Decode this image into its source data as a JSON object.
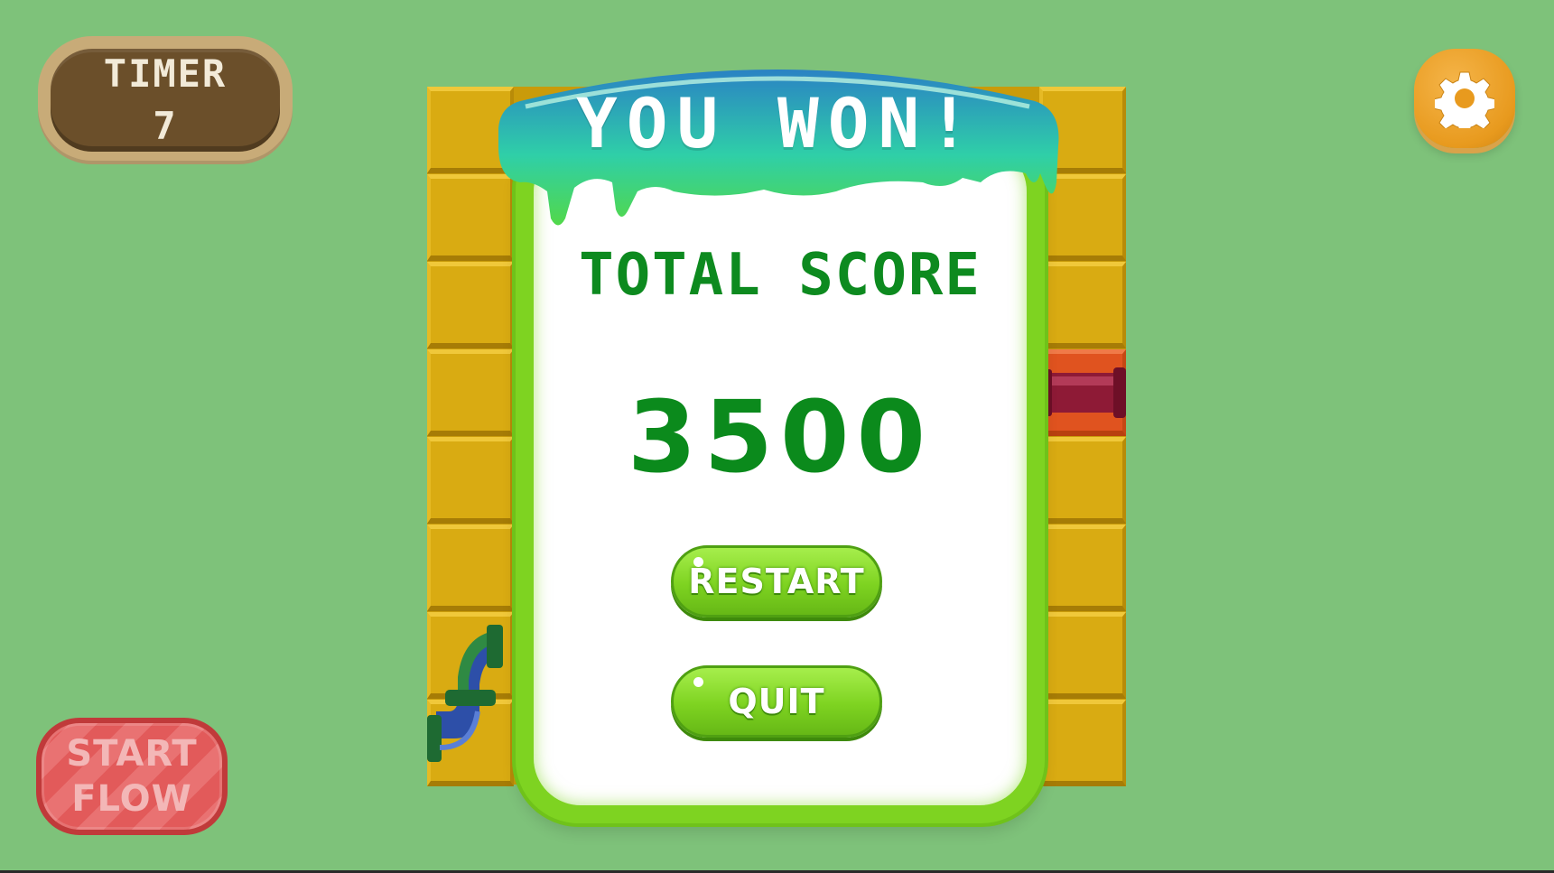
{
  "hud": {
    "timer_label": "TIMER",
    "timer_value": "7",
    "settings_icon": "gear-icon",
    "start_flow_line1": "START",
    "start_flow_line2": "FLOW"
  },
  "result": {
    "title": "YOU WON!",
    "score_label": "TOTAL SCORE",
    "score_value": "3500",
    "restart_label": "RESTART",
    "quit_label": "QUIT"
  },
  "colors": {
    "background": "#7ec27a",
    "tile": "#d9ab12",
    "pipe_end_tile": "#e0531f",
    "card_border": "#7ed321",
    "score_text": "#0b8a1c",
    "gear_button": "#e89a1e",
    "start_flow": "#e25a5a"
  }
}
